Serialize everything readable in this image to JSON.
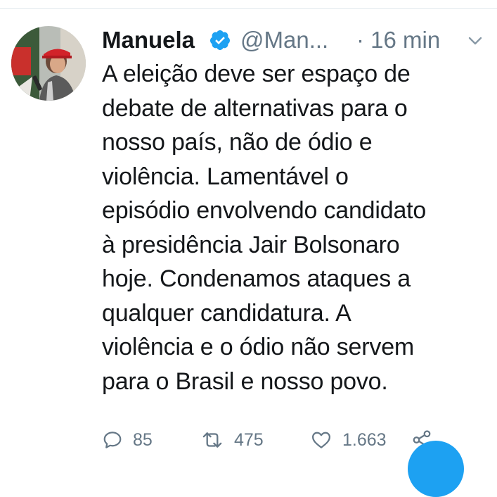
{
  "tweet": {
    "author_name": "Manuela",
    "handle": "@Man...",
    "timestamp": "· 16 min",
    "text": "A eleição deve ser espaço de\ndebate de alternativas para o\nnosso país, não de ódio e\nviolência. Lamentável o\nepisódio envolvendo candidato\nà presidência Jair Bolsonaro\nhoje. Condenamos ataques a\nqualquer candidatura. A\nviolência e o ódio não servem\npara o Brasil e nosso povo.",
    "verified_icon": "verified-badge-icon",
    "avatar_description_icon": "profile-avatar",
    "actions": {
      "replies": "85",
      "retweets": "475",
      "likes": "1.663"
    }
  },
  "colors": {
    "text": "#14171a",
    "secondary": "#657786",
    "brand_blue": "#1da1f2",
    "divider": "#e1e8ed"
  }
}
